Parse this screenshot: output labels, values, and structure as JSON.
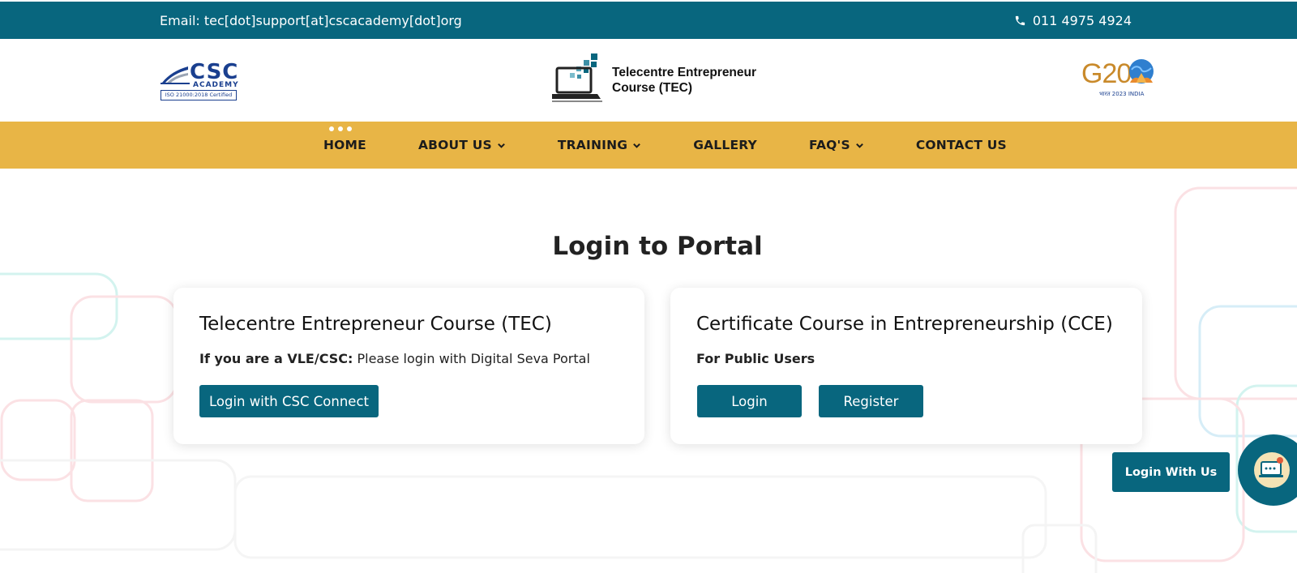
{
  "topbar": {
    "email": "Email: tec[dot]support[at]cscacademy[dot]org",
    "phone": "011 4975 4924",
    "phone_icon": "phone-icon"
  },
  "header": {
    "csc_logo": {
      "name": "CSC",
      "sub": "ACADEMY",
      "cert": "ISO 21000:2018 Certified"
    },
    "tec_logo": {
      "title": "Telecentre Entrepreneur Course (TEC)"
    },
    "g20_logo": {
      "text": "G20",
      "sub": "भारत 2023 INDIA"
    }
  },
  "nav": {
    "items": [
      {
        "label": "HOME",
        "dropdown": false
      },
      {
        "label": "ABOUT US",
        "dropdown": true
      },
      {
        "label": "TRAINING",
        "dropdown": true
      },
      {
        "label": "GALLERY",
        "dropdown": false
      },
      {
        "label": "FAQ'S",
        "dropdown": true
      },
      {
        "label": "CONTACT US",
        "dropdown": false
      }
    ]
  },
  "main": {
    "title": "Login to Portal",
    "cards": [
      {
        "title": "Telecentre Entrepreneur Course (TEC)",
        "desc_bold": "If you are a VLE/CSC:",
        "desc_text": " Please login with Digital Seva Portal",
        "buttons": [
          "Login with CSC Connect"
        ]
      },
      {
        "title": "Certificate Course in Entrepreneurship (CCE)",
        "desc_bold": "For Public Users",
        "desc_text": "",
        "buttons": [
          "Login",
          "Register"
        ]
      }
    ]
  },
  "floating": {
    "label": "Login With Us"
  },
  "colors": {
    "teal": "#08667e",
    "nav_yellow": "#e8b546"
  }
}
